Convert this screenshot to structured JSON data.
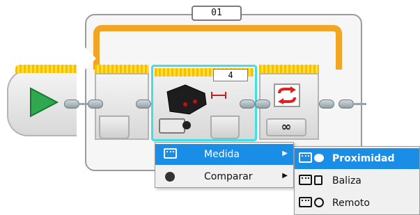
{
  "loop": {
    "counter_label": "01"
  },
  "blocks": {
    "sensor_port_value": "4",
    "loop_mode_symbol": "∞"
  },
  "menu": {
    "items": [
      {
        "label": "Medida",
        "selected": true,
        "has_submenu": true
      },
      {
        "label": "Comparar",
        "selected": false,
        "has_submenu": true
      }
    ],
    "submenu_arrow": "▶"
  },
  "submenu": {
    "items": [
      {
        "label": "Proximidad",
        "selected": true
      },
      {
        "label": "Baliza",
        "selected": false
      },
      {
        "label": "Remoto",
        "selected": false
      }
    ]
  },
  "colors": {
    "start_green": "#2fa84f",
    "loop_orange": "#f2a424",
    "selection_cyan": "#3fe0e6",
    "menu_highlight": "#1a8ee6",
    "stop_red": "#e02020"
  }
}
